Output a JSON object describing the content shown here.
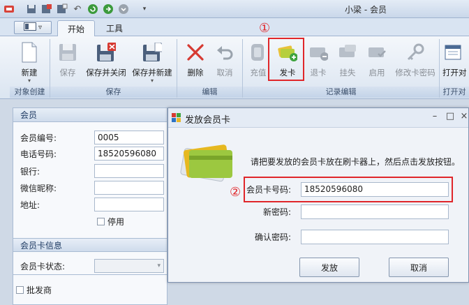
{
  "window": {
    "title": "小梁 - 会员"
  },
  "tabs": [
    {
      "label": "开始"
    },
    {
      "label": "工具"
    }
  ],
  "ribbon": {
    "groups": [
      {
        "label": "对象创建"
      },
      {
        "label": "保存"
      },
      {
        "label": "编辑"
      },
      {
        "label": "记录编辑"
      },
      {
        "label": "打开对"
      }
    ],
    "buttons": {
      "new": "新建",
      "save": "保存",
      "save_close": "保存并关闭",
      "save_new": "保存并新建",
      "delete": "删除",
      "cancel": "取消",
      "recharge": "充值",
      "issue_card": "发卡",
      "return_card": "退卡",
      "report_loss": "挂失",
      "enable": "启用",
      "change_password": "修改卡密码",
      "open": "打开对"
    }
  },
  "annotations": {
    "one": "①",
    "two": "②"
  },
  "member": {
    "section_title": "会员",
    "fields": {
      "number_label": "会员编号:",
      "number_value": "0005",
      "phone_label": "电话号码:",
      "phone_value": "18520596080",
      "bank_label": "银行:",
      "wechat_label": "微信昵称:",
      "address_label": "地址:",
      "disabled_label": "停用"
    }
  },
  "card_info": {
    "section_title": "会员卡信息",
    "status_label": "会员卡状态:"
  },
  "wholesaler_label": "批发商",
  "dialog": {
    "title": "发放会员卡",
    "message": "请把要发放的会员卡放在刷卡器上，然后点击发放按钮。",
    "card_no_label": "会员卡号码:",
    "card_no_value": "18520596080",
    "new_password_label": "新密码:",
    "confirm_password_label": "确认密码:",
    "issue_button": "发放",
    "cancel_button": "取消"
  },
  "colors": {
    "highlight": "#e0262a",
    "ribbon": "#dbe5f1",
    "accent": "#1f3b63"
  }
}
